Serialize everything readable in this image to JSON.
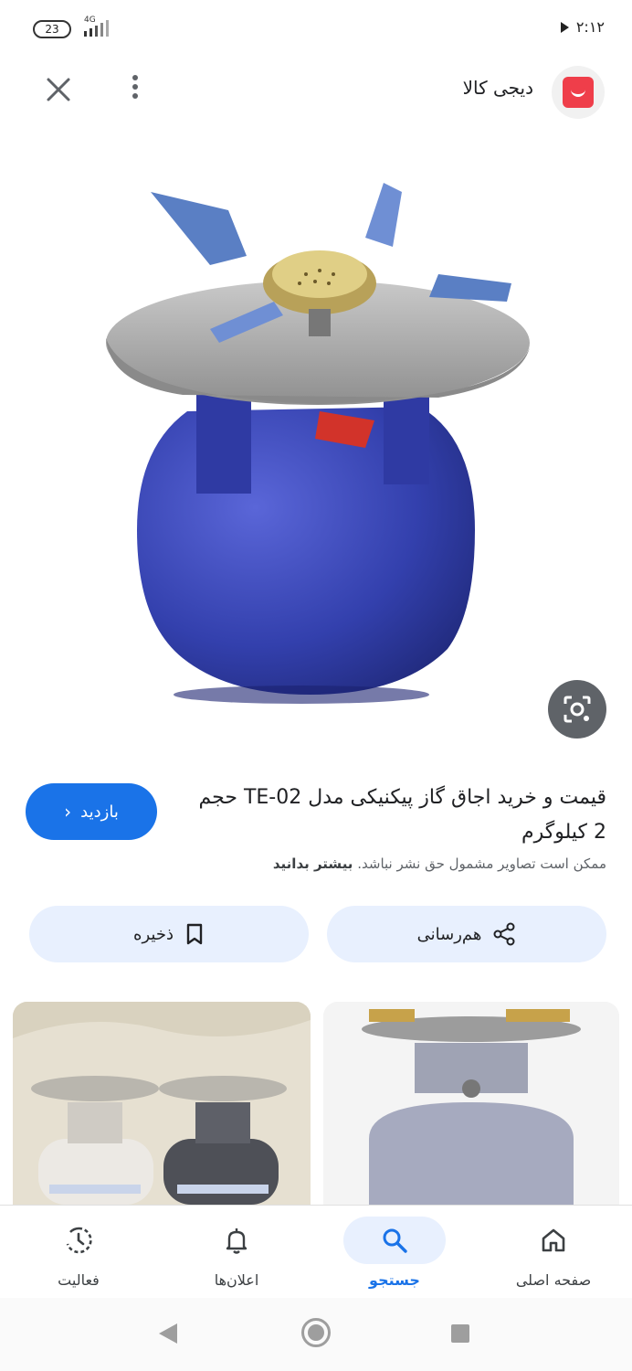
{
  "status_bar": {
    "battery": "23",
    "network": "4G",
    "time": "۲:۱۲"
  },
  "header": {
    "site_name": "دیجی کالا",
    "logo_color": "#ef3e4a"
  },
  "result": {
    "title": "قیمت و خرید اجاق گاز پیکنیکی مدل TE-02 حجم 2 کیلوگرم",
    "visit_label": "بازدید",
    "copyright_text": "ممکن است تصاویر مشمول حق نشر نباشد.",
    "learn_more": "بیشتر بدانید"
  },
  "actions": {
    "share_label": "هم‌رسانی",
    "save_label": "ذخیره"
  },
  "bottom_nav": {
    "items": [
      {
        "label": "صفحه اصلی",
        "icon": "home-icon"
      },
      {
        "label": "جستجو",
        "icon": "search-icon",
        "active": true
      },
      {
        "label": "اعلان‌ها",
        "icon": "bell-icon"
      },
      {
        "label": "فعالیت",
        "icon": "activity-icon"
      }
    ]
  },
  "colors": {
    "accent": "#1a73e8",
    "tonal": "#e8f0fe"
  }
}
